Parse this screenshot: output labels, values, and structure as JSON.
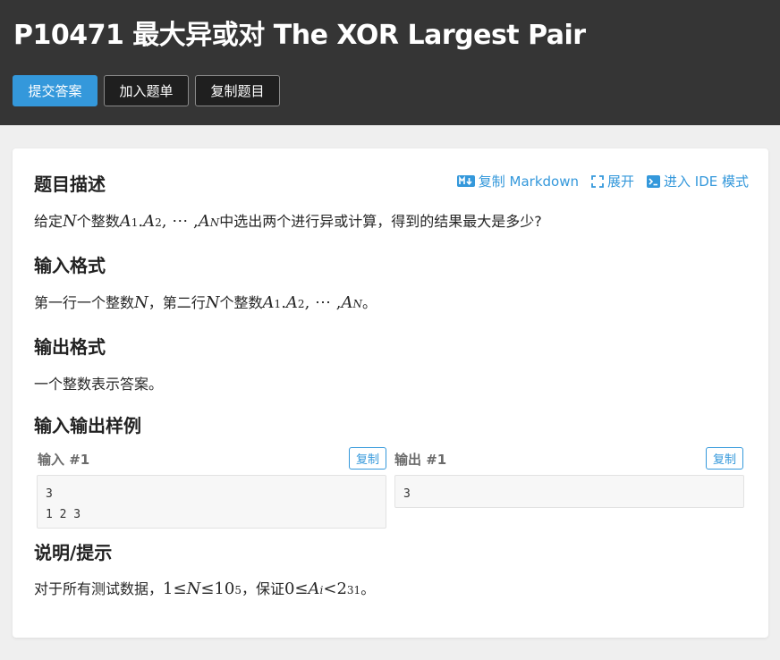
{
  "header": {
    "title": "P10471 最大异或对 The XOR Largest Pair",
    "buttons": {
      "submit": "提交答案",
      "add_to_list": "加入题单",
      "copy_problem": "复制题目"
    },
    "colors": {
      "background": "#353535",
      "primary": "#3498db"
    }
  },
  "tools": {
    "copy_markdown": "复制 Markdown",
    "expand": "展开",
    "ide_mode": "进入 IDE 模式"
  },
  "sections": {
    "description": {
      "heading": "题目描述",
      "prefix": "给定 ",
      "var_n": "N",
      "middle": " 个整数 ",
      "seq_a1": "A",
      "sub1": "1",
      "dot": ".",
      "seq_a2": "A",
      "sub2": "2",
      "ellipsis": ", ⋯ , ",
      "seq_an": "A",
      "subn": "N",
      "suffix": " 中选出两个进行异或计算，得到的结果最大是多少?"
    },
    "input_format": {
      "heading": "输入格式",
      "prefix": "第一行一个整数 ",
      "var_n": "N",
      "middle": "，第二行 ",
      "var_n2": "N",
      "middle2": " 个整数 ",
      "seq_a1": "A",
      "sub1": "1",
      "dot": ".",
      "seq_a2": "A",
      "sub2": "2",
      "ellipsis": ", ⋯ , ",
      "seq_an": "A",
      "subn": "N",
      "suffix": "。"
    },
    "output_format": {
      "heading": "输出格式",
      "text": "一个整数表示答案。"
    },
    "samples": {
      "heading": "输入输出样例",
      "input_label": "输入 #1",
      "output_label": "输出 #1",
      "copy": "复制",
      "input_data": "3\n1 2 3",
      "output_data": "3"
    },
    "hint": {
      "heading": "说明/提示",
      "prefix": "对于所有测试数据，",
      "one": "1",
      "le1": " ≤ ",
      "var_n": "N",
      "le2": " ≤ ",
      "ten": "10",
      "exp5": "5",
      "mid": "，保证 ",
      "zero": "0",
      "le3": " ≤ ",
      "var_a": "A",
      "sub_i": "i",
      "lt": " < ",
      "two": "2",
      "exp31": "31",
      "suffix": "。"
    }
  }
}
